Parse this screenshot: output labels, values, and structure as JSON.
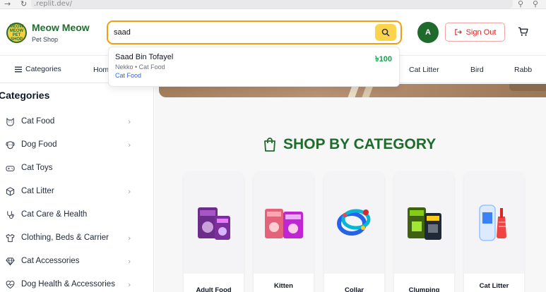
{
  "browser": {
    "back_glyph": "→",
    "refresh_glyph": "↻",
    "url": ".replit.dev/",
    "tool_glyph": "⚲"
  },
  "header": {
    "logo_text": "MEOW MEOW PET SHOP",
    "brand_name": "Meow Meow",
    "brand_sub": "Pet Shop",
    "search_value": "saad",
    "avatar_initial": "A",
    "signout_label": "Sign Out"
  },
  "search_results": [
    {
      "name": "Saad Bin Tofayel",
      "meta": "Nekko • Cat Food",
      "category": "Cat Food",
      "price": "৳100"
    }
  ],
  "navbar": {
    "categories_label": "Categories",
    "items": [
      "Hom",
      "Cat Litter",
      "Bird",
      "Rabb"
    ]
  },
  "sidebar": {
    "title": "Categories",
    "items": [
      {
        "label": "Cat Food",
        "icon": "cat-icon",
        "has_children": true
      },
      {
        "label": "Dog Food",
        "icon": "dog-icon",
        "has_children": true
      },
      {
        "label": "Cat Toys",
        "icon": "gamepad-icon",
        "has_children": false
      },
      {
        "label": "Cat Litter",
        "icon": "box-icon",
        "has_children": true
      },
      {
        "label": "Cat Care & Health",
        "icon": "stethoscope-icon",
        "has_children": false
      },
      {
        "label": "Clothing, Beds & Carrier",
        "icon": "shirt-icon",
        "has_children": true
      },
      {
        "label": "Cat Accessories",
        "icon": "gem-icon",
        "has_children": true
      },
      {
        "label": "Dog Health & Accessories",
        "icon": "heart-pulse-icon",
        "has_children": true
      }
    ],
    "chevron": "›"
  },
  "main": {
    "section_title": "SHOP BY CATEGORY",
    "categories": [
      {
        "label": "Adult Food"
      },
      {
        "label": "Kitten"
      },
      {
        "label": "Collar"
      },
      {
        "label": "Clumping"
      },
      {
        "label": "Cat Litter"
      }
    ]
  },
  "colors": {
    "brand_green": "#1e6f2e",
    "search_border": "#f59e0b",
    "search_button": "#fcd34d",
    "signout_red": "#dc2626",
    "price_green": "#16a34a",
    "link_blue": "#2563eb"
  }
}
